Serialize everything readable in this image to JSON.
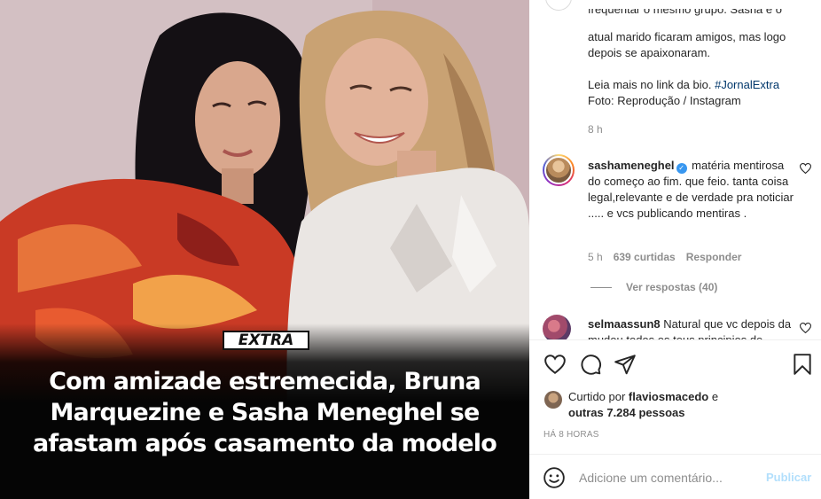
{
  "post": {
    "image_logo": "EXTRA",
    "headline": "Com amizade estremecida, Bruna Marquezine e Sasha Meneghel se afastam após casamento da modelo"
  },
  "caption": {
    "cut_line": "frequentar o mesmo grupo. Sasha e o",
    "line1": "atual marido ficaram amigos, mas logo",
    "line2": "depois se apaixonaram.",
    "line3_prefix": "Leia mais no link da bio. ",
    "hashtag": "#JornalExtra",
    "line4": "Foto: Reprodução / Instagram",
    "time": "8 h"
  },
  "comments": [
    {
      "username": "sashameneghel",
      "verified": true,
      "text": "matéria mentirosa do começo ao fim. que feio. tanta coisa legal,relevante e de verdade pra noticiar ..... e vcs publicando mentiras .",
      "time": "5 h",
      "likes": "639 curtidas",
      "reply_label": "Responder",
      "view_replies": "Ver respostas (40)"
    },
    {
      "username": "selmaassun8",
      "text": "Natural que vc depois da mudou todos os teus principios de"
    }
  ],
  "likes": {
    "prefix": "Curtido por ",
    "user": "flaviosmacedo",
    "connector": " e",
    "others": "outras 7.284 pessoas"
  },
  "post_time": "HÁ 8 HORAS",
  "comment_box": {
    "placeholder": "Adicione um comentário...",
    "publish_label": "Publicar"
  },
  "icons": {
    "like": "heart-icon",
    "comment": "comment-icon",
    "share": "share-icon",
    "save": "bookmark-icon",
    "emoji": "emoji-icon"
  }
}
